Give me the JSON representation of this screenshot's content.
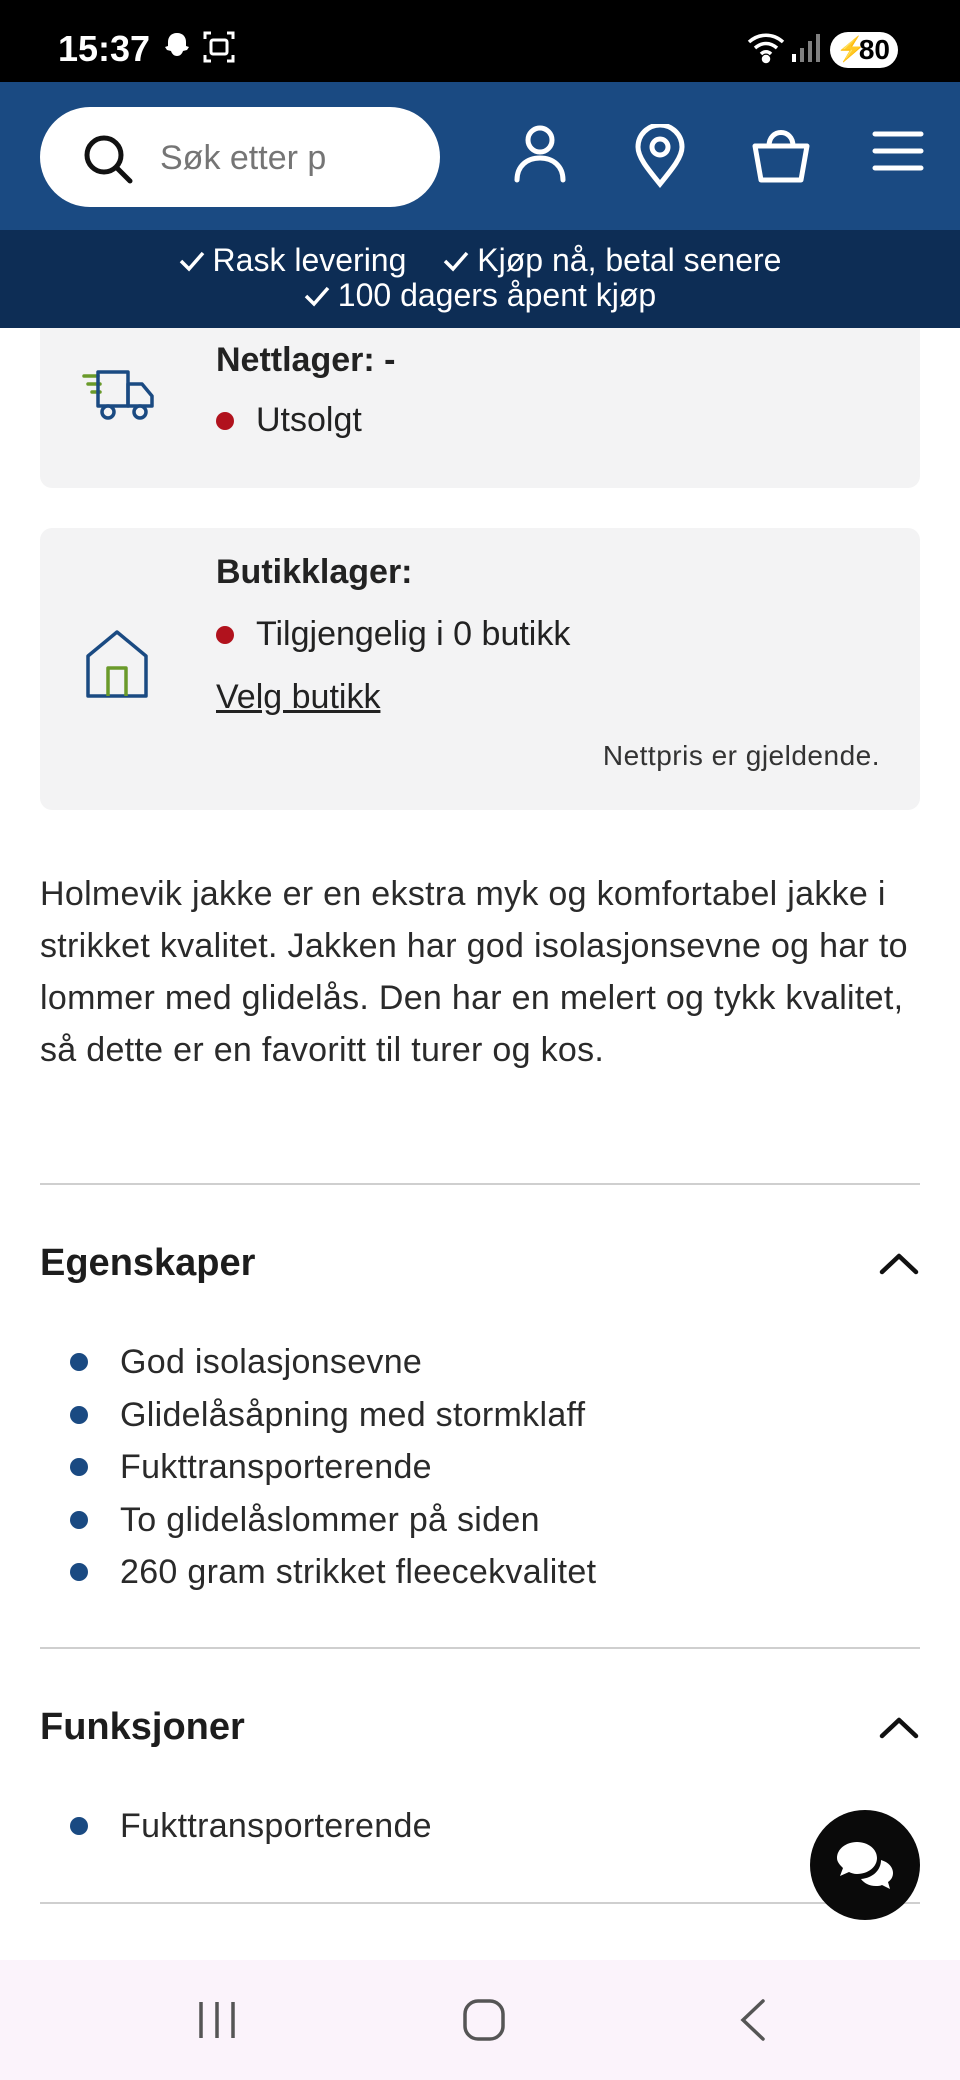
{
  "status_bar": {
    "time": "15:37",
    "battery": "80",
    "icons": [
      "snapchat-icon",
      "screenshot-icon",
      "wifi-icon",
      "signal-icon",
      "battery-charging-icon"
    ]
  },
  "header": {
    "search_placeholder": "Søk etter p",
    "icons": [
      "search-icon",
      "account-icon",
      "location-pin-icon",
      "shopping-basket-icon",
      "menu-icon"
    ]
  },
  "benefits": [
    {
      "label": "Rask levering"
    },
    {
      "label": "Kjøp nå, betal senere"
    },
    {
      "label": "100 dagers åpent kjøp"
    }
  ],
  "online_stock": {
    "title": "Nettlager: -",
    "status": "Utsolgt",
    "icon": "delivery-truck-icon"
  },
  "store_stock": {
    "title": "Butikklager:",
    "status": "Tilgjengelig i 0 butikk",
    "link": "Velg butikk",
    "note": "Nettpris er gjeldende.",
    "icon": "store-house-icon"
  },
  "description": "Holmevik jakke er en ekstra myk og komfortabel jakke i strikket kvalitet. Jakken har god isolasjonsevne og har to lommer med glidelås. Den har en melert og tykk kvalitet, så dette er en favoritt til turer og kos.",
  "features": {
    "title": "Egenskaper",
    "items": [
      "God isolasjonsevne",
      "Glidelåsåpning med stormklaff",
      "Fukttransporterende",
      "To glidelåslommer på siden",
      "260 gram strikket fleecekvalitet"
    ]
  },
  "functions": {
    "title": "Funksjoner",
    "items": [
      "Fukttransporterende"
    ]
  },
  "colors": {
    "brand_blue": "#1a4a82",
    "dark_navy": "#0d2d55",
    "stock_red": "#b1121d",
    "card_bg": "#f3f3f4"
  }
}
